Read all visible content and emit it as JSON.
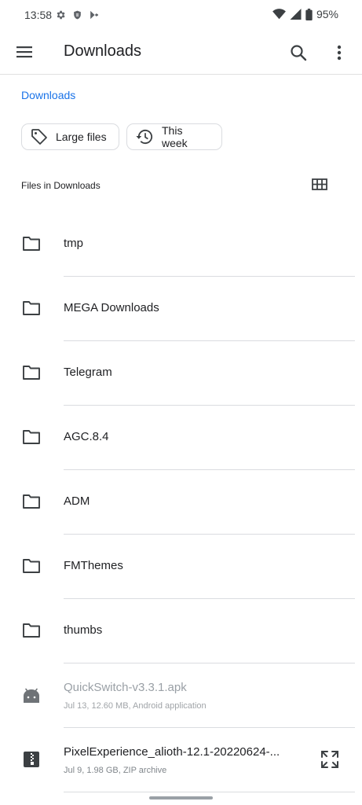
{
  "status_bar": {
    "time": "13:58",
    "battery": "95%",
    "left_icons": [
      "settings-icon",
      "shield-icon",
      "play-store-icon"
    ],
    "right_icons": [
      "wifi-icon",
      "signal-icon",
      "battery-icon"
    ]
  },
  "app_bar": {
    "title": "Downloads",
    "icons": [
      "menu-icon",
      "search-icon",
      "more-vert-icon"
    ]
  },
  "breadcrumb": "Downloads",
  "chips": [
    {
      "label": "Large files",
      "icon": "tag-icon"
    },
    {
      "label": "This week",
      "icon": "history-icon"
    }
  ],
  "section": {
    "label": "Files in Downloads",
    "view_icon": "grid-view-icon"
  },
  "folders": [
    {
      "name": "tmp"
    },
    {
      "name": "MEGA Downloads"
    },
    {
      "name": "Telegram"
    },
    {
      "name": "AGC.8.4"
    },
    {
      "name": "ADM"
    },
    {
      "name": "FMThemes"
    },
    {
      "name": "thumbs"
    }
  ],
  "files": [
    {
      "name": "QuickSwitch-v3.3.1.apk",
      "meta": "Jul 13, 12.60 MB, Android application",
      "icon": "android-icon"
    },
    {
      "name": "PixelExperience_alioth-12.1-20220624-...",
      "meta": "Jul 9, 1.98 GB, ZIP archive",
      "icon": "zip-icon",
      "action_icon": "expand-icon"
    }
  ],
  "colors": {
    "accent": "#1a73e8",
    "text": "#202124",
    "secondary_text": "#80868b",
    "divider": "#dadce0"
  }
}
